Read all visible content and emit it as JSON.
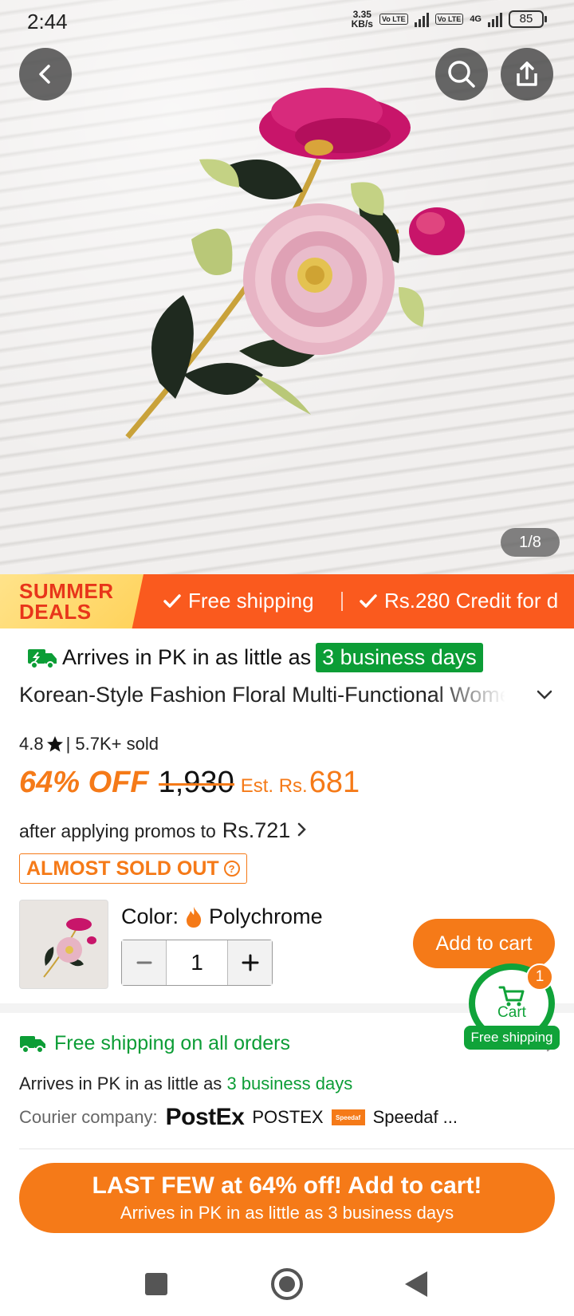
{
  "status_bar": {
    "time": "2:44",
    "speed_value": "3.35",
    "speed_unit": "KB/s",
    "volte1": "Vo LTE",
    "volte2": "Vo LTE",
    "network": "4G",
    "battery": "85"
  },
  "hero": {
    "image_icon": "floral-brooch-photo",
    "counter": "1/8"
  },
  "banner": {
    "deals_line1": "SUMMER",
    "deals_line2": "DEALS",
    "item1": "Free shipping",
    "item2": "Rs.280 Credit for d"
  },
  "product": {
    "arrives_prefix": "Arrives in PK in as little as",
    "arrives_days": "3 business days",
    "title": "Korean-Style Fashion Floral Multi-Functional Women's Brooch",
    "rating": "4.8",
    "sold": "| 5.7K+ sold",
    "discount": "64% OFF",
    "original_price": "1,930",
    "est_label": "Est. Rs.",
    "est_price": "681",
    "promo_prefix": "after applying promos to",
    "promo_price": "Rs.721",
    "stock_badge": "ALMOST SOLD OUT",
    "color_label": "Color:",
    "color_value": "Polychrome",
    "quantity": "1",
    "add_to_cart": "Add to cart"
  },
  "cart_widget": {
    "label": "Cart",
    "count": "1",
    "free": "Free shipping"
  },
  "shipping": {
    "title": "Free shipping on all orders",
    "arrives_prefix": "Arrives in PK in as little as",
    "arrives_days": "3 business days",
    "courier_label": "Courier company:",
    "postex_logo": "PostEx",
    "postex_name": "POSTEX",
    "speedaf_logo": "Speedaf",
    "speedaf_name": "Speedaf ..."
  },
  "cta": {
    "line1": "LAST FEW at 64% off! Add to cart!",
    "line2": "Arrives in PK in as little as 3 business days"
  },
  "colors": {
    "accent": "#f57a18",
    "banner": "#fa5a1e",
    "green": "#0c9d36"
  }
}
